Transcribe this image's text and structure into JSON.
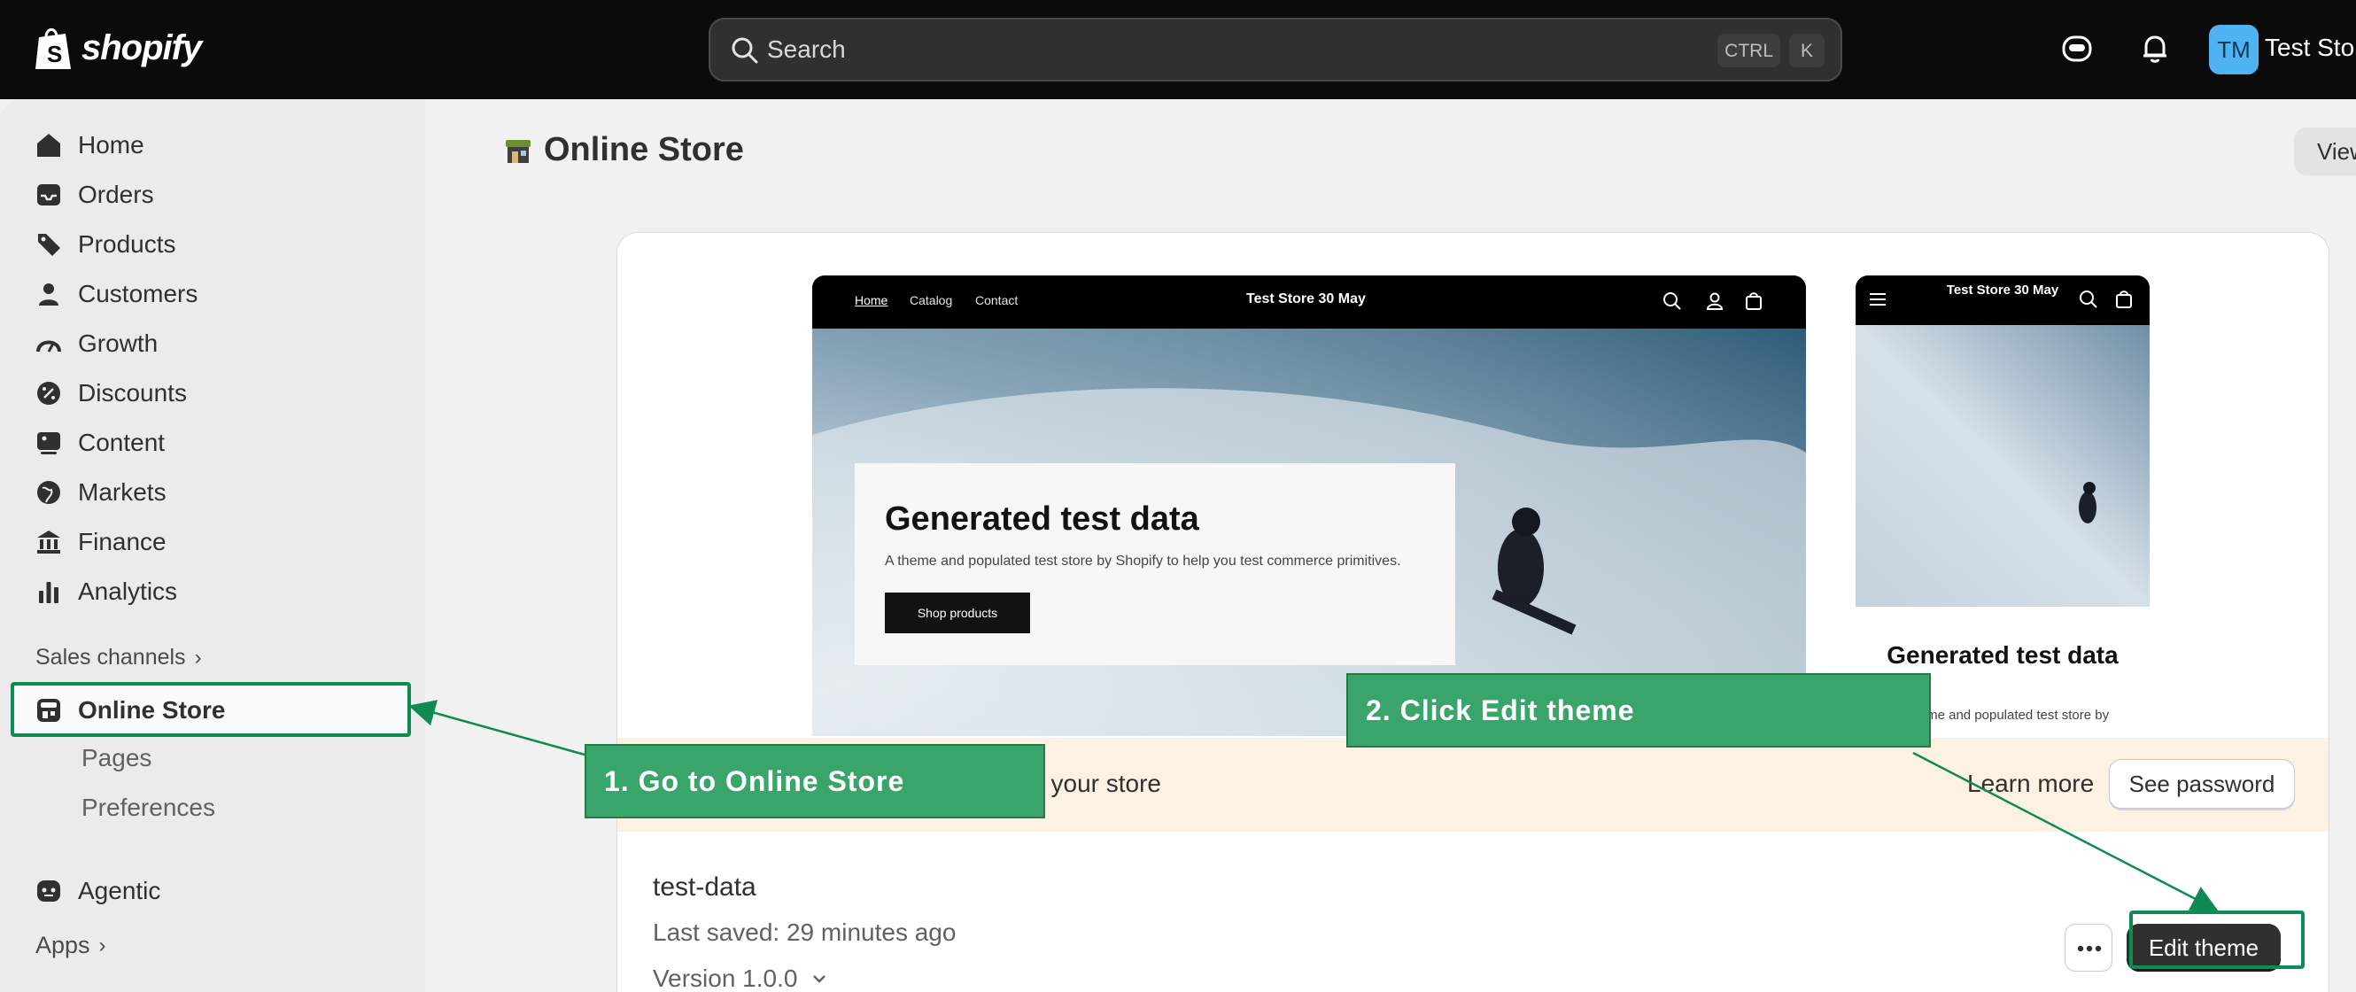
{
  "topbar": {
    "brand": "shopify",
    "search_placeholder": "Search",
    "shortcut_modifier": "CTRL",
    "shortcut_key": "K",
    "avatar_initials": "TM",
    "store_name": "Test Store"
  },
  "sidebar": {
    "items": [
      {
        "label": "Home",
        "icon": "home-icon"
      },
      {
        "label": "Orders",
        "icon": "inbox-icon"
      },
      {
        "label": "Products",
        "icon": "tag-icon"
      },
      {
        "label": "Customers",
        "icon": "person-icon"
      },
      {
        "label": "Growth",
        "icon": "gauge-icon"
      },
      {
        "label": "Discounts",
        "icon": "discount-icon"
      },
      {
        "label": "Content",
        "icon": "image-icon"
      },
      {
        "label": "Markets",
        "icon": "globe-icon"
      },
      {
        "label": "Finance",
        "icon": "bank-icon"
      },
      {
        "label": "Analytics",
        "icon": "bar-chart-icon"
      }
    ],
    "sales_channels_label": "Sales channels",
    "online_store_label": "Online Store",
    "pages_label": "Pages",
    "preferences_label": "Preferences",
    "agentic_label": "Agentic",
    "apps_label": "Apps"
  },
  "page": {
    "title": "Online Store",
    "view_button": "View"
  },
  "preview": {
    "desktop_nav": [
      "Home",
      "Catalog",
      "Contact"
    ],
    "desktop_store_title": "Test Store 30 May",
    "hero_title": "Generated test data",
    "hero_subtitle": "A theme and populated test store by Shopify to help you test commerce primitives.",
    "hero_button": "Shop products",
    "mobile_store_title": "Test Store 30 May",
    "mobile_heading": "Generated test data",
    "mobile_subtitle": "A theme and populated test store by"
  },
  "banner": {
    "text": "Visitors need the password to access your store",
    "learn_more": "Learn more",
    "see_password": "See password"
  },
  "theme": {
    "name": "test-data",
    "last_saved": "Last saved: 29 minutes ago",
    "version": "Version 1.0.0",
    "edit_button": "Edit theme"
  },
  "annotations": {
    "step1": "1. Go to Online Store",
    "step2": "2. Click Edit theme",
    "color": "#3aa56b"
  }
}
